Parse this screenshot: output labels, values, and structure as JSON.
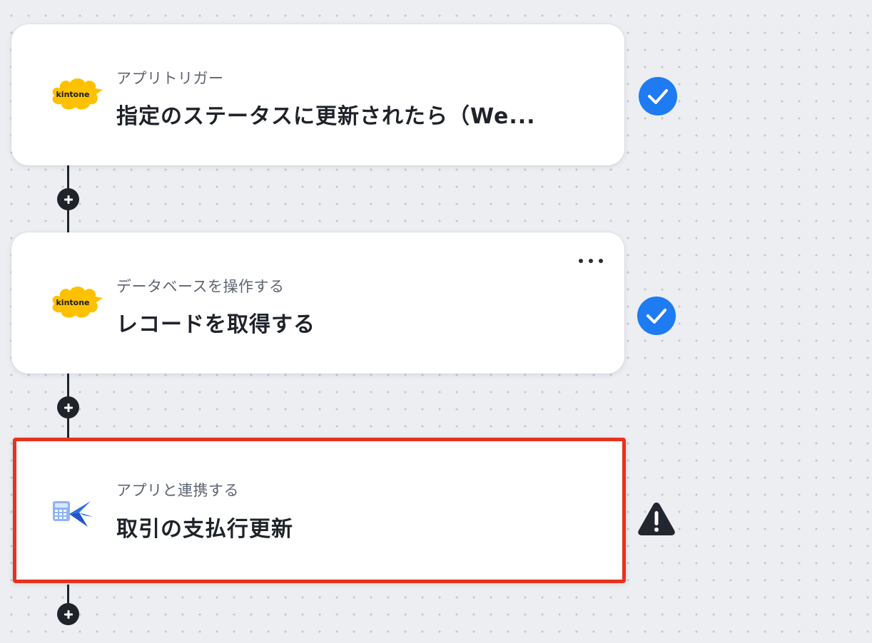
{
  "steps": [
    {
      "app": "kintone",
      "logo_text": "kintone",
      "kicker": "アプリトリガー",
      "title": "指定のステータスに更新されたら（We...",
      "status": "complete"
    },
    {
      "app": "kintone",
      "logo_text": "kintone",
      "kicker": "データベースを操作する",
      "title": "レコードを取得する",
      "status": "complete",
      "has_more_menu": true
    },
    {
      "app": "freee-accounting",
      "kicker": "アプリと連携する",
      "title": "取引の支払行更新",
      "status": "warning",
      "selected": true
    }
  ],
  "add_step_buttons": 3,
  "colors": {
    "check": "#1e7bf2",
    "selected_border": "#e8321c",
    "kintone_yellow": "#fdc100",
    "warning": "#22262e",
    "canvas_bg": "#eceef2"
  },
  "icons": {
    "complete": "check-circle-icon",
    "warning": "warning-triangle-icon",
    "add": "plus-circle-icon",
    "more": "more-horizontal-icon"
  }
}
